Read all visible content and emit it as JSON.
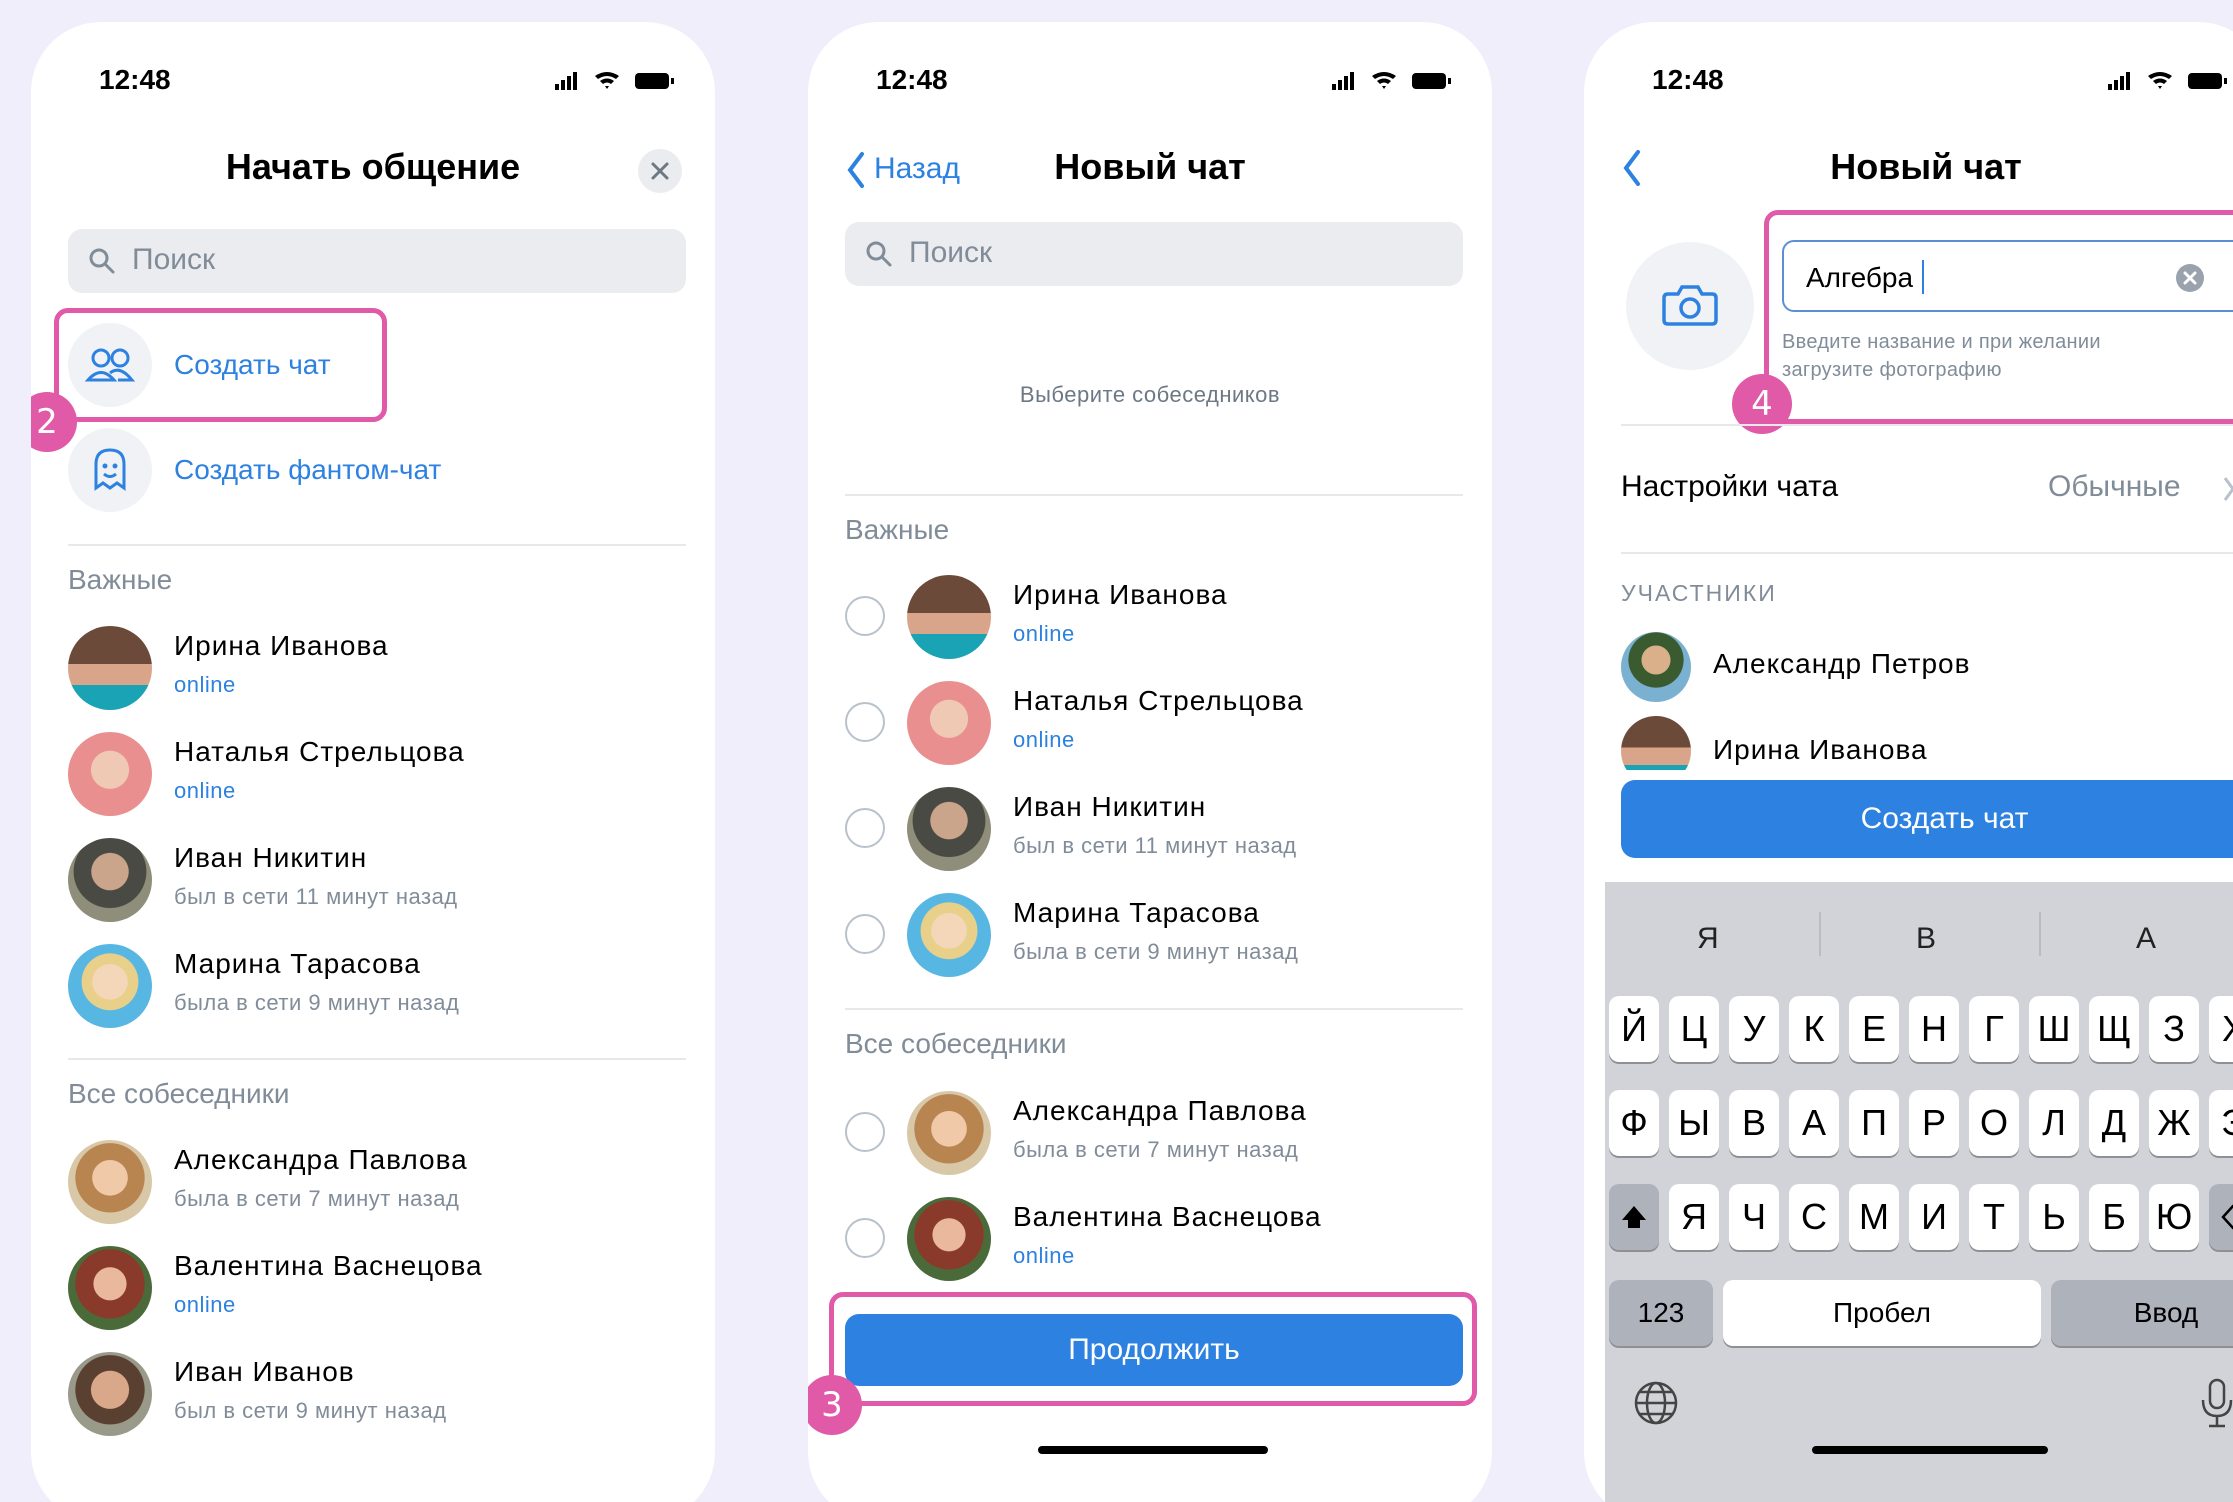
{
  "screen1": {
    "time": "12:48",
    "title": "Начать общение",
    "search_placeholder": "Поиск",
    "create_chat": "Создать чат",
    "create_phantom_chat": "Создать фантом-чат",
    "section_important": "Важные",
    "section_all": "Все собеседники",
    "badge": "2",
    "important": [
      {
        "name": "Ирина Иванова",
        "status": "online"
      },
      {
        "name": "Наталья Стрельцова",
        "status": "online"
      },
      {
        "name": "Иван Никитин",
        "status": "был в сети 11 минут назад"
      },
      {
        "name": "Марина Тарасова",
        "status": "была в сети 9 минут назад"
      }
    ],
    "all": [
      {
        "name": "Александра Павлова",
        "status": "была в сети 7 минут назад"
      },
      {
        "name": "Валентина Васнецова",
        "status": "online"
      },
      {
        "name": "Иван Иванов",
        "status": "был в сети 9 минут назад"
      }
    ]
  },
  "screen2": {
    "time": "12:48",
    "back": "Назад",
    "title": "Новый чат",
    "search_placeholder": "Поиск",
    "hint": "Выберите собеседников",
    "section_important": "Важные",
    "section_all": "Все собеседники",
    "important": [
      {
        "name": "Ирина Иванова",
        "status": "online"
      },
      {
        "name": "Наталья Стрельцова",
        "status": "online"
      },
      {
        "name": "Иван Никитин",
        "status": "был в сети 11 минут назад"
      },
      {
        "name": "Марина Тарасова",
        "status": "была в сети 9 минут назад"
      }
    ],
    "all": [
      {
        "name": "Александра Павлова",
        "status": "была в сети 7 минут назад"
      },
      {
        "name": "Валентина Васнецова",
        "status": "online"
      }
    ],
    "continue": "Продолжить",
    "badge": "3"
  },
  "screen3": {
    "time": "12:48",
    "title": "Новый чат",
    "chat_name_value": "Алгебра",
    "name_hint_line1": "Введите название и при желании",
    "name_hint_line2": "загрузите фотографию",
    "badge": "4",
    "settings_label": "Настройки чата",
    "settings_value": "Обычные",
    "participants_header": "УЧАСТНИКИ",
    "participants": [
      "Александр Петров",
      "Ирина Иванова"
    ],
    "create_button": "Создать чат",
    "keyboard": {
      "suggestions": [
        "Я",
        "В",
        "А"
      ],
      "row1": [
        "Й",
        "Ц",
        "У",
        "К",
        "Е",
        "Н",
        "Г",
        "Ш",
        "Щ",
        "З",
        "Х"
      ],
      "row2": [
        "Ф",
        "Ы",
        "В",
        "А",
        "П",
        "Р",
        "О",
        "Л",
        "Д",
        "Ж",
        "Э"
      ],
      "row3": [
        "Я",
        "Ч",
        "С",
        "М",
        "И",
        "Т",
        "Ь",
        "Б",
        "Ю"
      ],
      "num_key": "123",
      "space_key": "Пробел",
      "enter_key": "Ввод"
    }
  },
  "colors": {
    "accent": "#2d81e0",
    "highlight": "#e05aa8",
    "background": "#f0eefb"
  }
}
